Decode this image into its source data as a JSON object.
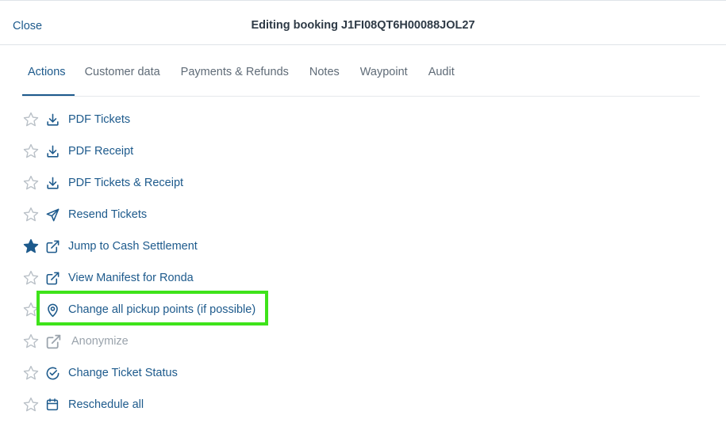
{
  "header": {
    "close_label": "Close",
    "title": "Editing booking J1FI08QT6H00088JOL27"
  },
  "tabs": [
    {
      "label": "Actions",
      "active": true
    },
    {
      "label": "Customer data",
      "active": false
    },
    {
      "label": "Payments & Refunds",
      "active": false
    },
    {
      "label": "Notes",
      "active": false
    },
    {
      "label": "Waypoint",
      "active": false
    },
    {
      "label": "Audit",
      "active": false
    }
  ],
  "actions": [
    {
      "label": "PDF Tickets",
      "icon": "download-icon",
      "starred": false,
      "disabled": false
    },
    {
      "label": "PDF Receipt",
      "icon": "download-icon",
      "starred": false,
      "disabled": false
    },
    {
      "label": "PDF Tickets & Receipt",
      "icon": "download-icon",
      "starred": false,
      "disabled": false
    },
    {
      "label": "Resend Tickets",
      "icon": "send-icon",
      "starred": false,
      "disabled": false
    },
    {
      "label": "Jump to Cash Settlement",
      "icon": "external-link-icon",
      "starred": true,
      "disabled": false
    },
    {
      "label": "View Manifest for Ronda",
      "icon": "external-link-icon",
      "starred": false,
      "disabled": false
    },
    {
      "label": "Change all pickup points (if possible)",
      "icon": "map-pin-icon",
      "starred": false,
      "disabled": false,
      "highlighted": true
    },
    {
      "label": "Anonymize",
      "icon": "external-link-icon",
      "starred": false,
      "disabled": true
    },
    {
      "label": "Change Ticket Status",
      "icon": "check-circle-icon",
      "starred": false,
      "disabled": false
    },
    {
      "label": "Reschedule all",
      "icon": "calendar-icon",
      "starred": false,
      "disabled": false
    }
  ],
  "colors": {
    "link": "#1d5a8c",
    "star_filled": "#1d5a8c",
    "star_outline": "#b9c0c7",
    "highlight_border": "#3ee31a",
    "disabled": "#9aa3ac"
  }
}
